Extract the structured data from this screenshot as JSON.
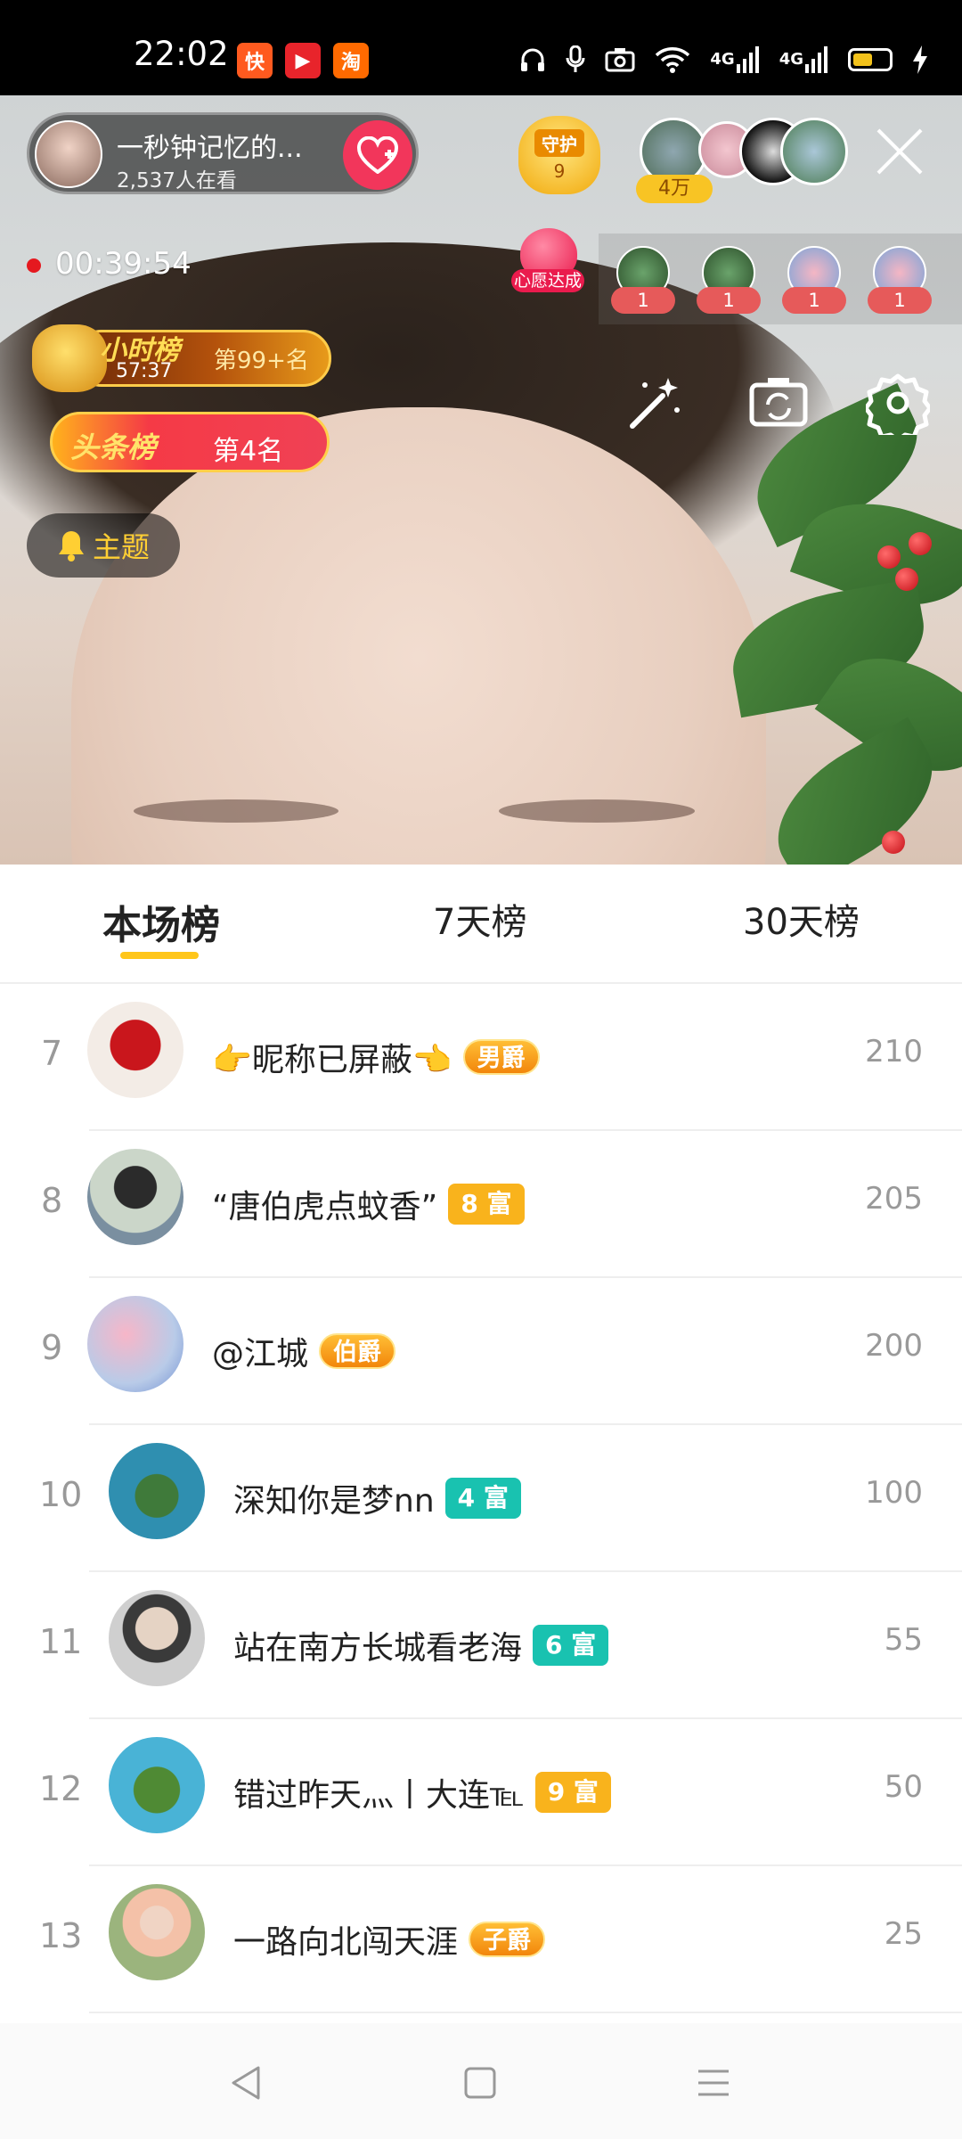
{
  "status_bar": {
    "time": "22:02",
    "app_icons": [
      {
        "name": "kuaishou-app-icon",
        "glyph": "快",
        "color": "#ff5a1f"
      },
      {
        "name": "video-app-icon",
        "glyph": "▶",
        "color": "#e8242b"
      },
      {
        "name": "taobao-app-icon",
        "glyph": "淘",
        "color": "#ff6a00"
      }
    ],
    "network_label_1": "4G",
    "network_label_2": "4G",
    "battery_percent": 55
  },
  "live": {
    "host_name": "一秒钟记忆的...",
    "viewer_count": "2,537人在看",
    "guard_label": "守护",
    "guard_count": "9",
    "fan_badge": "4万",
    "elapsed_time": "00:39:54",
    "wish_label": "心愿达成",
    "gift_counts": [
      "1",
      "1",
      "1",
      "1"
    ],
    "hour_rank_title": "小时榜",
    "hour_rank_time": "57:37",
    "hour_rank_position": "第99+名",
    "headline_title": "头条榜",
    "headline_position": "第4名",
    "topic_label": "主题"
  },
  "leaderboard": {
    "tabs": [
      {
        "label": "本场榜",
        "active": true
      },
      {
        "label": "7天榜",
        "active": false
      },
      {
        "label": "30天榜",
        "active": false
      }
    ],
    "rows": [
      {
        "rank": "7",
        "name": "👉昵称已屏蔽👈",
        "badge_text": "男爵",
        "badge_type": "noble",
        "score": "210"
      },
      {
        "rank": "8",
        "name": "“唐伯虎点蚊香”",
        "badge_text": "8 富",
        "badge_type": "rich",
        "badge_color": "#f9b31c",
        "score": "205"
      },
      {
        "rank": "9",
        "name": "@江城",
        "badge_text": "伯爵",
        "badge_type": "noble",
        "score": "200"
      },
      {
        "rank": "10",
        "name": "深知你是梦nn",
        "badge_text": "4 富",
        "badge_type": "rich",
        "badge_color": "#19c2b0",
        "score": "100"
      },
      {
        "rank": "11",
        "name": "站在南方长城看老海",
        "badge_text": "6 富",
        "badge_type": "rich",
        "badge_color": "#19c2b0",
        "score": "55"
      },
      {
        "rank": "12",
        "name": "错过昨天灬丨大连℡",
        "badge_text": "9 富",
        "badge_type": "rich",
        "badge_color": "#f9b31c",
        "score": "50"
      },
      {
        "rank": "13",
        "name": "一路向北闯天涯",
        "badge_text": "子爵",
        "badge_type": "noble",
        "score": "25"
      }
    ]
  }
}
